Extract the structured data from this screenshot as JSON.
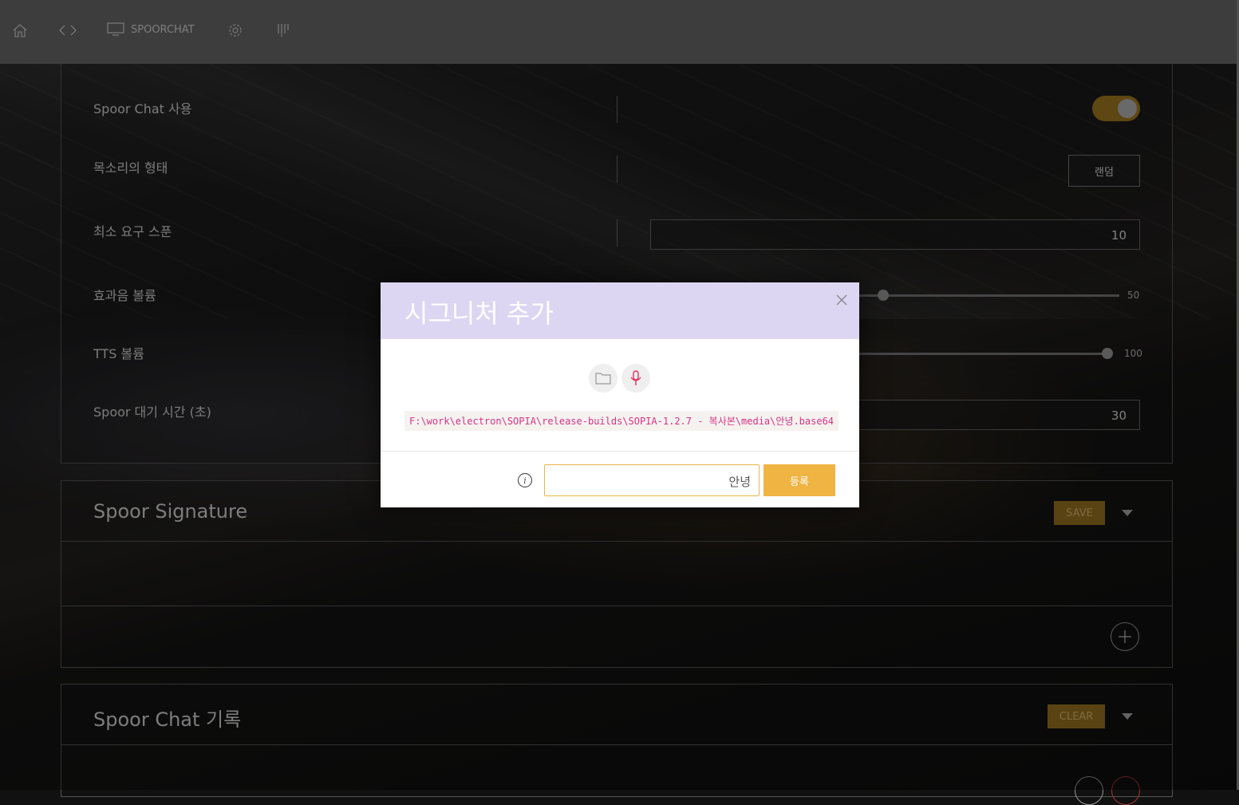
{
  "nav": {
    "app_label": "SPOORCHAT",
    "icons": [
      "home-icon",
      "code-icon",
      "monitor-icon",
      "gear-icon",
      "equalizer-icon"
    ]
  },
  "settings": {
    "spoor_chat_enable_label": "Spoor Chat 사용",
    "spoor_chat_enabled": true,
    "voice_type_label": "목소리의 형태",
    "voice_type_value": "랜덤",
    "min_spoon_label": "최소 요구 스푼",
    "min_spoon_value": "10",
    "effect_volume_label": "효과음 볼륨",
    "effect_volume_value": "50",
    "tts_volume_label": "TTS 볼륨",
    "tts_volume_value": "100",
    "wait_time_label": "Spoor 대기 시간 (초)",
    "wait_time_value": "30"
  },
  "signature_panel": {
    "title": "Spoor Signature",
    "save_label": "SAVE"
  },
  "history_panel": {
    "title": "Spoor Chat 기록",
    "clear_label": "CLEAR"
  },
  "modal": {
    "title": "시그니처 추가",
    "file_path": "F:\\work\\electron\\SOPIA\\release-builds\\SOPIA-1.2.7 - 복사본\\media\\안녕.base64",
    "name_value": "안녕",
    "register_label": "등록"
  },
  "colors": {
    "accent_gold": "#9b7420",
    "modal_header": "#dcd6f2",
    "register_button": "#f0b443",
    "path_text": "#d63384"
  }
}
